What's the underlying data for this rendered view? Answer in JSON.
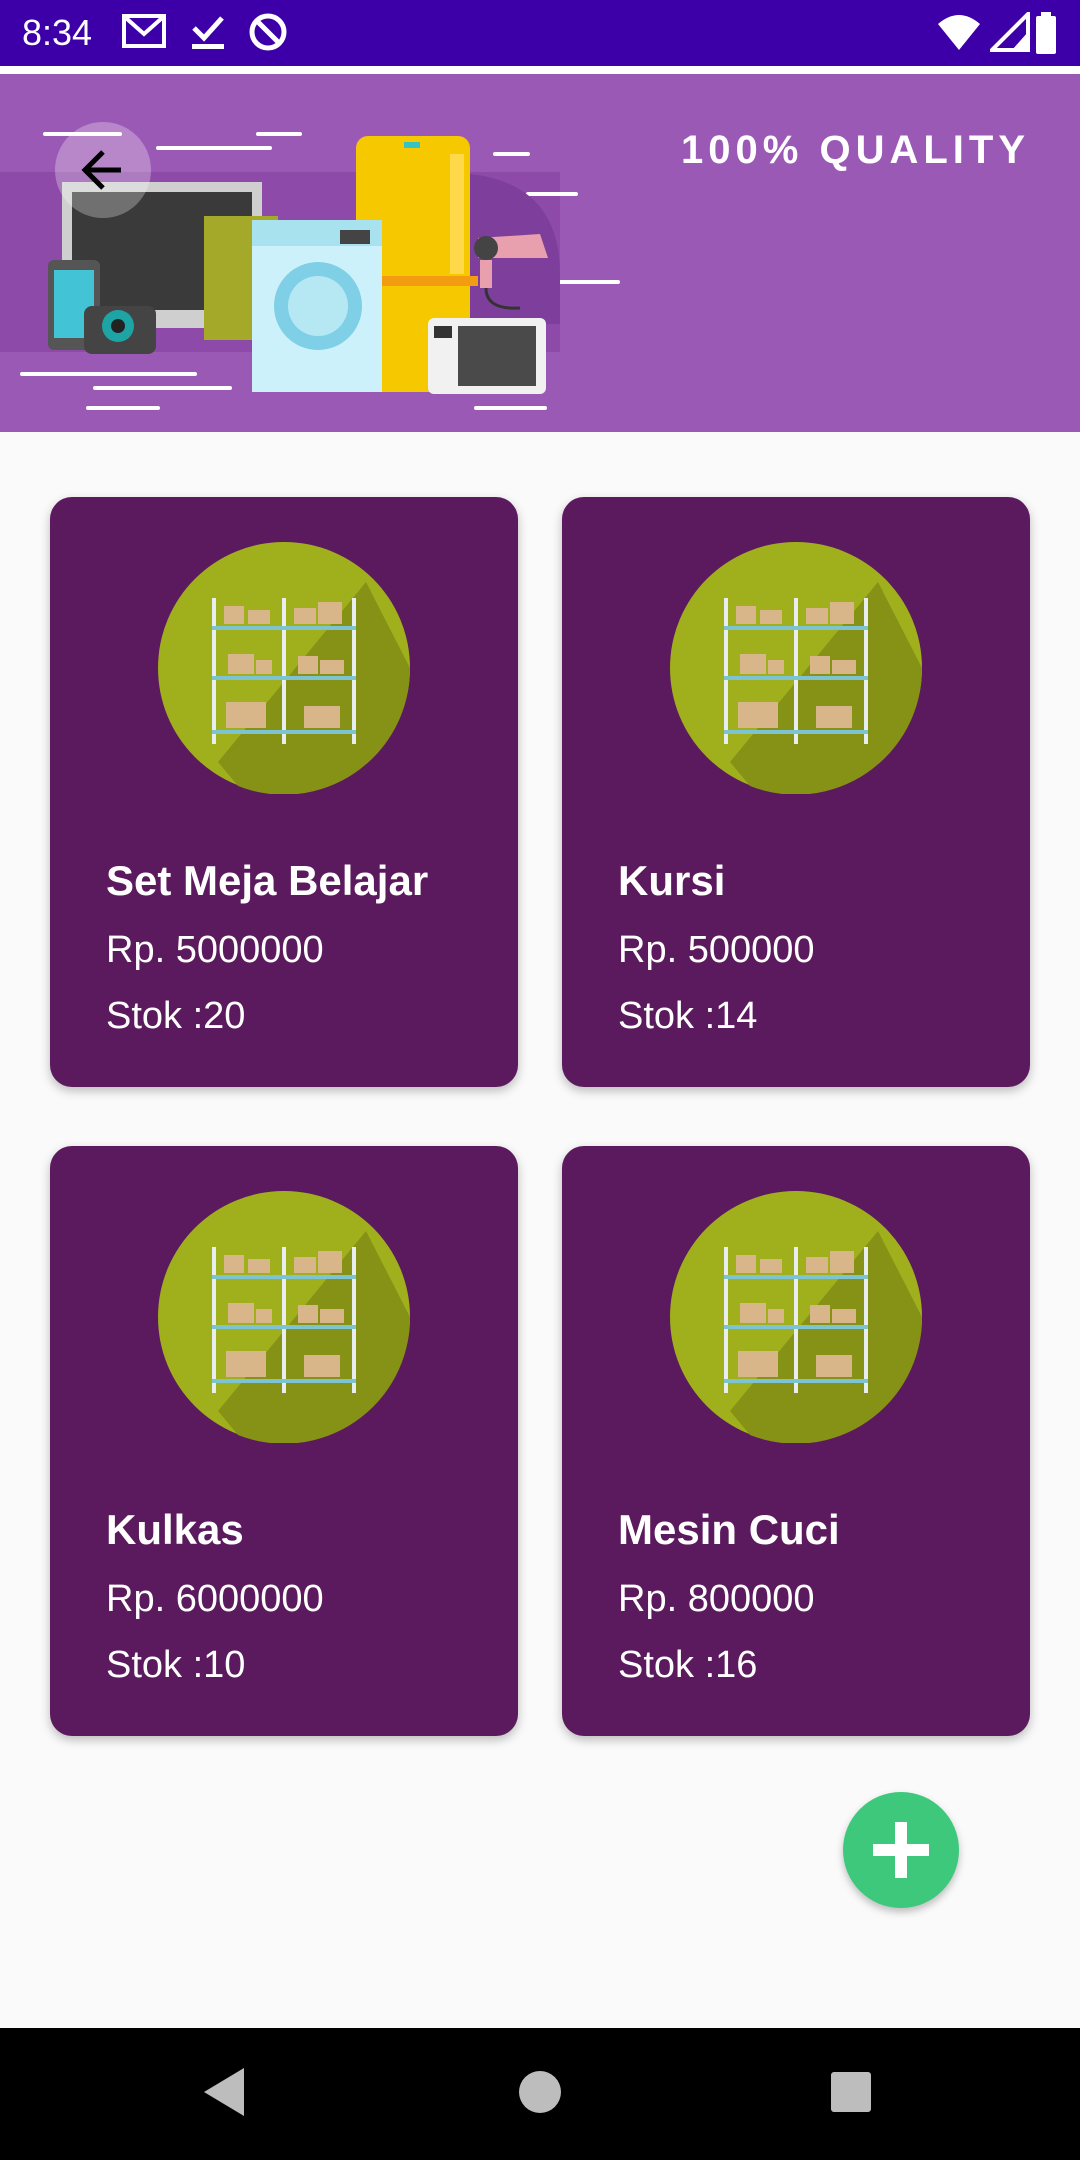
{
  "status_bar": {
    "time": "8:34",
    "left_icons": [
      "gmail-icon",
      "task-check-icon",
      "at-sign-icon"
    ],
    "right_icons": [
      "wifi-icon",
      "signal-icon",
      "battery-icon"
    ],
    "background": "#3d00a8"
  },
  "header": {
    "back_icon": "arrow-left-icon",
    "banner_text": "100% QUALITY",
    "banner_color": "#9b59b6"
  },
  "products": [
    {
      "name": "Set Meja Belajar",
      "price": "Rp. 5000000",
      "stock": "Stok :20",
      "image": "warehouse-shelves-icon"
    },
    {
      "name": "Kursi",
      "price": "Rp. 500000",
      "stock": "Stok :14",
      "image": "warehouse-shelves-icon"
    },
    {
      "name": "Kulkas",
      "price": "Rp. 6000000",
      "stock": "Stok :10",
      "image": "warehouse-shelves-icon"
    },
    {
      "name": "Mesin Cuci",
      "price": "Rp. 800000",
      "stock": "Stok :16",
      "image": "warehouse-shelves-icon"
    }
  ],
  "colors": {
    "card": "#5c1a5e",
    "circle": "#a0b01c",
    "fab": "#3ec87c"
  },
  "fab": {
    "icon": "plus-icon"
  },
  "nav_bar": {
    "buttons": [
      "back-triangle-icon",
      "home-circle-icon",
      "recents-square-icon"
    ]
  }
}
